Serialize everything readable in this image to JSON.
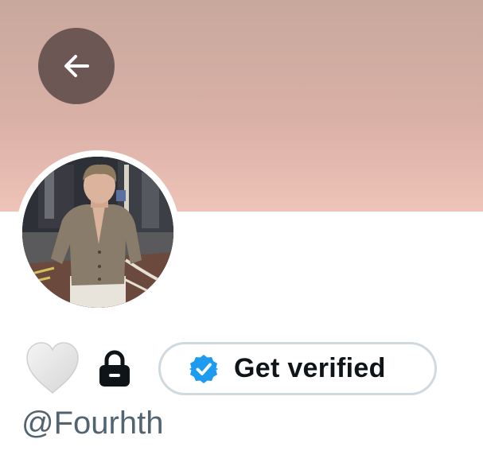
{
  "header": {
    "back_icon": "arrow-left-icon",
    "banner_color_top": "#c8a89c",
    "banner_color_bottom": "#eec3b8"
  },
  "profile": {
    "avatar_alt": "profile photo",
    "handle": "@Fourhth"
  },
  "actions": {
    "heart_icon": "white-heart-icon",
    "lock_icon": "lock-icon",
    "verify_label": "Get verified",
    "verify_badge_icon": "verified-badge-icon",
    "verify_badge_color": "#1d9bf0"
  }
}
